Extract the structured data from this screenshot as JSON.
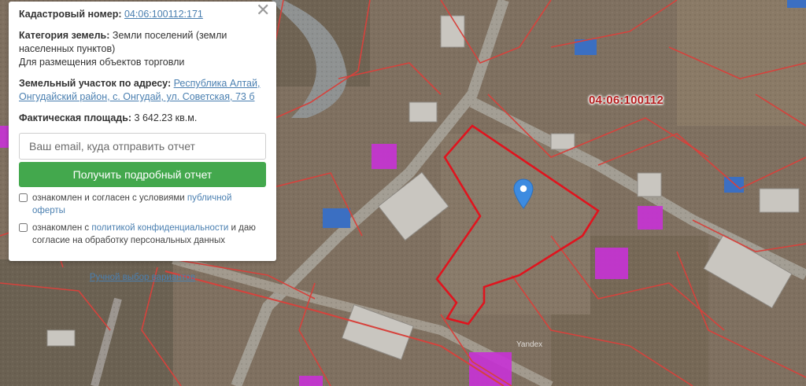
{
  "panel": {
    "cadastral": {
      "label": "Кадастровый номер:",
      "value": "04:06:100112:171"
    },
    "category": {
      "label": "Категория земель:",
      "value": "Земли поселений (земли населенных пунктов)",
      "use": "Для размещения объектов торговли"
    },
    "address": {
      "label": "Земельный участок по адресу:",
      "value": "Республика Алтай, Онгудайский район, с. Онгудай, ул. Советская, 73 б"
    },
    "area": {
      "label": "Фактическая площадь:",
      "value": "3 642.23 кв.м."
    },
    "email_placeholder": "Ваш email, куда отправить отчет",
    "report_button": "Получить подробный отчет",
    "consent1": {
      "text": "ознакомлен и согласен с условиями",
      "link": "публичной оферты"
    },
    "consent2": {
      "text": "ознакомлен с",
      "link": "политикой конфиденциальности",
      "text2": "и даю согласие на обработку персональных данных"
    },
    "manual_link": "Ручной выбор вариантов",
    "close_symbol": "✕"
  },
  "map": {
    "quarter_label": "04:06:100112",
    "provider": "Yandex",
    "plot_outline_color": "#e0141e",
    "parcel_line_color": "#d6423c",
    "pin_color": "#3d8be0",
    "highlight_color": "#c832d6"
  }
}
